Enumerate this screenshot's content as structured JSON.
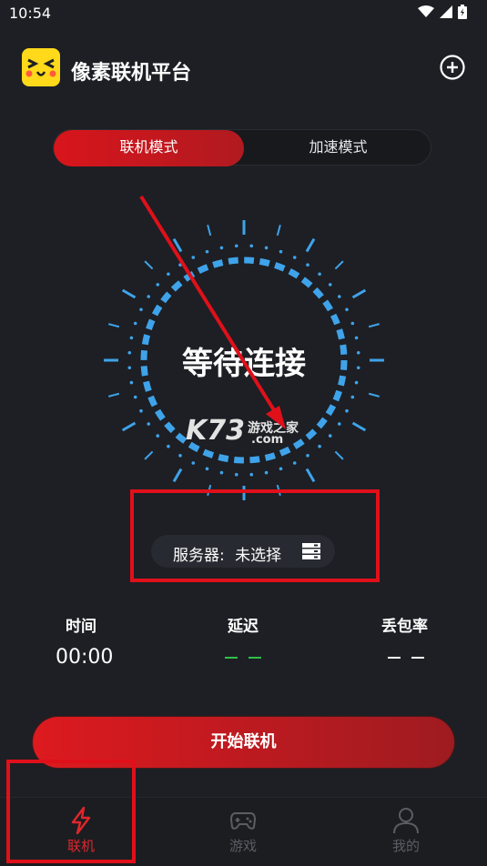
{
  "status_bar": {
    "time": "10:54"
  },
  "app": {
    "title": "像素联机平台"
  },
  "modes": [
    {
      "label": "联机模式",
      "active": true
    },
    {
      "label": "加速模式",
      "active": false
    }
  ],
  "dial": {
    "status_text": "等待连接"
  },
  "watermark": {
    "brand": "K73",
    "sub": "游戏之家",
    "domain": ".com"
  },
  "server": {
    "label": "服务器:",
    "value": "未选择"
  },
  "stats": [
    {
      "label": "时间",
      "value": "00:00"
    },
    {
      "label": "延迟",
      "value": "",
      "dash_color": "#2ec24a"
    },
    {
      "label": "丢包率",
      "value": "",
      "dash_color": "#ffffff"
    }
  ],
  "start_button": {
    "label": "开始联机"
  },
  "bottom_nav": [
    {
      "label": "联机",
      "icon": "lightning-icon",
      "active": true
    },
    {
      "label": "游戏",
      "icon": "gamepad-icon",
      "active": false
    },
    {
      "label": "我的",
      "icon": "user-icon",
      "active": false
    }
  ],
  "colors": {
    "accent": "#d8151c",
    "dial": "#3fa3ea",
    "background": "#1d1f24",
    "annotation": "#e0101a"
  }
}
